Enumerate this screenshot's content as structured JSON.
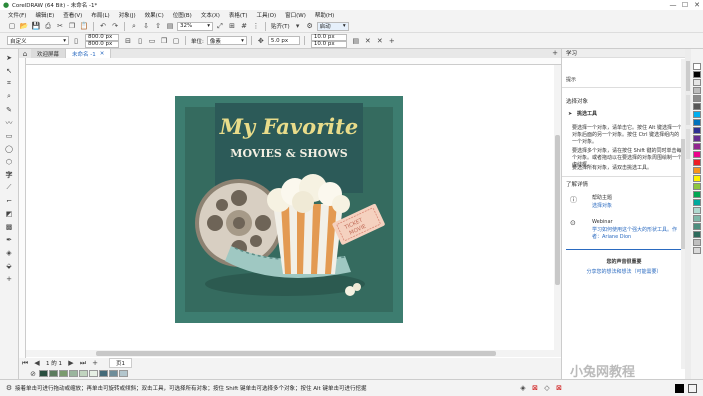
{
  "window": {
    "title": "CorelDRAW (64 Bit) - 未命名 -1*"
  },
  "menu": [
    "文件(F)",
    "编辑(E)",
    "查看(V)",
    "布局(L)",
    "对象(J)",
    "效果(C)",
    "位图(B)",
    "文本(X)",
    "表格(T)",
    "工具(O)",
    "窗口(W)",
    "帮助(H)"
  ],
  "toolbar": {
    "zoom": "32%",
    "snap_label": "贴齐(T)",
    "launch_label": "启动"
  },
  "propbar": {
    "preset": "自定义",
    "width": "800.0 px",
    "height": "800.0 px",
    "units_label": "单位:",
    "units": "像素",
    "nudge": "5.0 px",
    "dup_x": "10.0 px",
    "dup_y": "10.0 px"
  },
  "tabs": {
    "welcome": "欢迎屏幕",
    "doc": "未命名 -1"
  },
  "artwork": {
    "title": "My Favorite",
    "subtitle": "MOVIES & SHOWS",
    "ticket_1": "TICKET",
    "ticket_2": "MOVIE"
  },
  "pagenav": {
    "counter": "1 的 1",
    "page": "页1"
  },
  "status": {
    "hint": "接着单击可进行拖动或缩放；再单击可旋转或倾斜；双击工具，可选择所有对象；按住 Shift 键单击可选择多个对象；按住 Alt 键单击可进行挖掘"
  },
  "docker": {
    "tab_label": "提示",
    "section1": "选择对象",
    "tool_name": "挑选工具",
    "bullets": [
      "要选择一个对象，请单击它。按住 Alt 键选择一个对象后面的另一个对象。按住 Ctrl 键选择组内的一个对象。",
      "要选择多个对象，请在按住 Shift 键的同时单击每个对象。或者拖动以在要选择的对象周围绘制一个虚线框。",
      "要选择所有对象，请双击挑选工具。"
    ],
    "learn_more": "了解详情",
    "help_topic": "帮助主题",
    "help_link": "选择对象",
    "webinar": "Webinar",
    "webinar_desc": "学习如何使用这个强大的形状工具。作者：Ariane Dion",
    "footer_title": "您的声音很重要",
    "footer_link": "分享您的想法和想法（可能需要）",
    "watermark": "小兔网教程"
  },
  "palette_h": [
    "#2a4e3f",
    "#5b7a5d",
    "#7a9a6e",
    "#9bb59e",
    "#c1d4bf",
    "#e6efe4",
    "#446a78",
    "#6f8d99",
    "#b3c6cd"
  ],
  "palette_v": [
    "#ffffff",
    "#000000",
    "#e5e5e5",
    "#bdbdbd",
    "#8c8c8c",
    "#595959",
    "#00aeef",
    "#0072bc",
    "#2e3192",
    "#662d91",
    "#92278f",
    "#ec008c",
    "#ed1c24",
    "#f7941d",
    "#fff200",
    "#8dc63f",
    "#00a651",
    "#00a99d",
    "#b0d9cf",
    "#7fb7a8",
    "#4d8e7e",
    "#2d6b5c",
    "#bfbfbf",
    "#d9d9d9"
  ]
}
